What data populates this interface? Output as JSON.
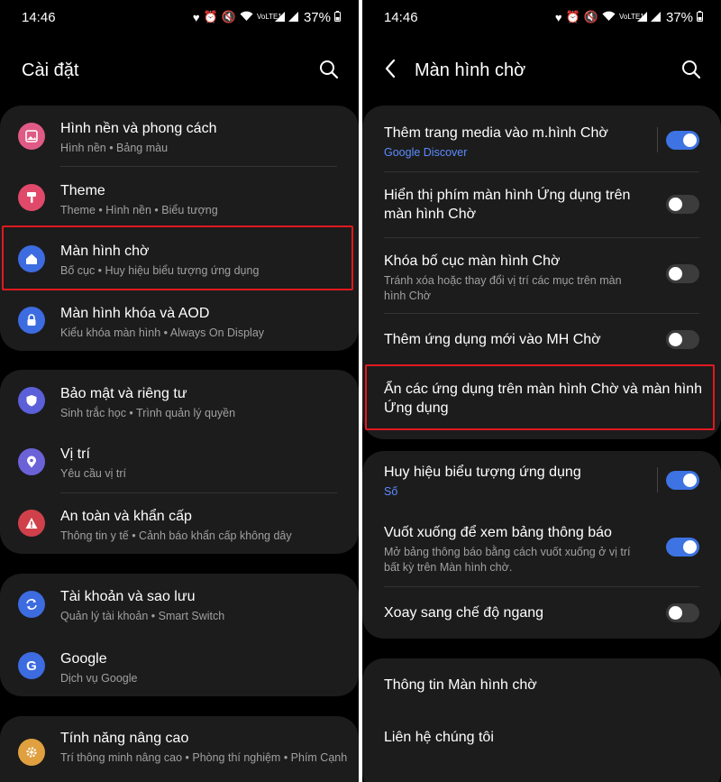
{
  "status": {
    "time": "14:46",
    "battery": "37%",
    "network": "VoLTE1"
  },
  "colors": {
    "accent": "#3d73e3",
    "link": "#5b8cff",
    "highlight": "#e0191f"
  },
  "left": {
    "title": "Cài đặt",
    "groups": [
      {
        "items": [
          {
            "title": "Hình nền và phong cách",
            "subtitle": "Hình nền  •  Bảng màu",
            "icon": "wallpaper-icon",
            "color": "#e05a86"
          },
          {
            "title": "Theme",
            "subtitle": "Theme  •  Hình nền  •  Biểu tượng",
            "icon": "theme-icon",
            "color": "#e0496a"
          },
          {
            "title": "Màn hình chờ",
            "subtitle": "Bố cục  •  Huy hiệu biểu tượng ứng dụng",
            "icon": "home-icon",
            "color": "#3d6be0"
          },
          {
            "title": "Màn hình khóa và AOD",
            "subtitle": "Kiểu khóa màn hình  •  Always On Display",
            "icon": "lock-icon",
            "color": "#3d6be0"
          }
        ]
      },
      {
        "items": [
          {
            "title": "Bảo mật và riêng tư",
            "subtitle": "Sinh trắc học  •  Trình quản lý quyền",
            "icon": "shield-icon",
            "color": "#5b5fd8"
          },
          {
            "title": "Vị trí",
            "subtitle": "Yêu cầu vị trí",
            "icon": "location-icon",
            "color": "#6b62d8"
          },
          {
            "title": "An toàn và khẩn cấp",
            "subtitle": "Thông tin y tế  •  Cảnh báo khẩn cấp không dây",
            "icon": "warning-icon",
            "color": "#d0404a"
          }
        ]
      },
      {
        "items": [
          {
            "title": "Tài khoản và sao lưu",
            "subtitle": "Quản lý tài khoản  •  Smart Switch",
            "icon": "sync-icon",
            "color": "#3d6be0"
          },
          {
            "title": "Google",
            "subtitle": "Dịch vụ Google",
            "icon": "google-icon",
            "color": "#3d6be0"
          }
        ]
      },
      {
        "items": [
          {
            "title": "Tính năng nâng cao",
            "subtitle": "Trí thông minh nâng cao  •  Phòng thí nghiệm  •  Phím Cạnh",
            "icon": "gear-plus-icon",
            "color": "#e0a040"
          }
        ]
      }
    ]
  },
  "right": {
    "title": "Màn hình chờ",
    "group1": [
      {
        "title": "Thêm trang media vào m.hình Chờ",
        "subtitle": "Google Discover",
        "toggle": true
      },
      {
        "title": "Hiển thị phím màn hình Ứng dụng trên màn hình Chờ",
        "subtitle": "",
        "toggle": false
      },
      {
        "title": "Khóa bố cục màn hình Chờ",
        "subtitle": "Tránh xóa hoặc thay đổi vị trí các mục trên màn hình Chờ",
        "toggle": false
      },
      {
        "title": "Thêm ứng dụng mới vào MH Chờ",
        "subtitle": "",
        "toggle": false
      },
      {
        "title": "Ẩn các ứng dụng trên màn hình Chờ và màn hình Ứng dụng",
        "subtitle": ""
      }
    ],
    "group2": [
      {
        "title": "Huy hiệu biểu tượng ứng dụng",
        "subtitle": "Số",
        "toggle": true
      },
      {
        "title": "Vuốt xuống để xem bảng thông báo",
        "subtitle": "Mở bảng thông báo bằng cách vuốt xuống ở vị trí bất kỳ trên Màn hình chờ.",
        "toggle": true
      },
      {
        "title": "Xoay sang chế độ ngang",
        "subtitle": "",
        "toggle": false
      }
    ],
    "group3": [
      {
        "title": "Thông tin Màn hình chờ"
      },
      {
        "title": "Liên hệ chúng tôi"
      }
    ]
  }
}
